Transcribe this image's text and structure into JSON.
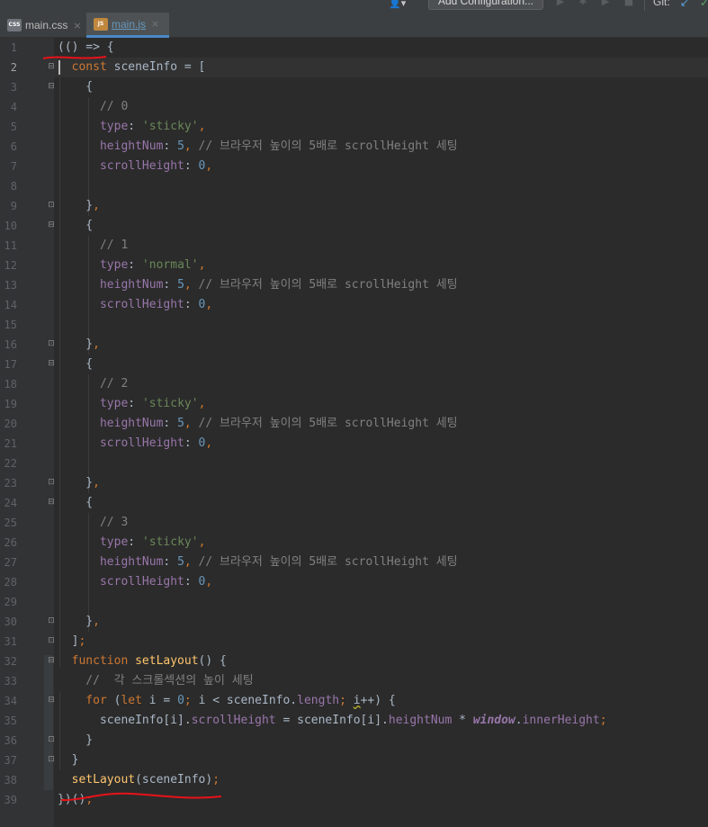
{
  "toolbar": {
    "user_icon": "user-account-icon",
    "config_label": "Add Configuration...",
    "git_label": "Git:"
  },
  "tabs": [
    {
      "label": "main.css",
      "icon_text": "CSS",
      "icon": "css-file-icon",
      "active": false
    },
    {
      "label": "main.js",
      "icon_text": "JS",
      "icon": "js-file-icon",
      "active": true
    }
  ],
  "editor": {
    "current_line": 2,
    "lines": [
      {
        "n": "1",
        "t": [
          [
            "pl",
            "(() => {"
          ]
        ]
      },
      {
        "n": "2",
        "t": [
          [
            "kw",
            "  const "
          ],
          [
            "pl",
            "sceneInfo = ["
          ]
        ]
      },
      {
        "n": "3",
        "t": [
          [
            "pl",
            "    {"
          ]
        ]
      },
      {
        "n": "4",
        "t": [
          [
            "cm",
            "      // 0"
          ]
        ]
      },
      {
        "n": "5",
        "t": [
          [
            "prop",
            "      type"
          ],
          [
            "pl",
            ": "
          ],
          [
            "str",
            "'sticky'"
          ],
          [
            "kw",
            ","
          ]
        ]
      },
      {
        "n": "6",
        "t": [
          [
            "prop",
            "      heightNum"
          ],
          [
            "pl",
            ": "
          ],
          [
            "num",
            "5"
          ],
          [
            "kw",
            ", "
          ],
          [
            "cm",
            "// 브라우저 높이의 5배로 scrollHeight 세팅"
          ]
        ]
      },
      {
        "n": "7",
        "t": [
          [
            "prop",
            "      scrollHeight"
          ],
          [
            "pl",
            ": "
          ],
          [
            "num",
            "0"
          ],
          [
            "kw",
            ","
          ]
        ]
      },
      {
        "n": "8",
        "t": []
      },
      {
        "n": "9",
        "t": [
          [
            "pl",
            "    }"
          ],
          [
            "kw",
            ","
          ]
        ]
      },
      {
        "n": "10",
        "t": [
          [
            "pl",
            "    {"
          ]
        ]
      },
      {
        "n": "11",
        "t": [
          [
            "cm",
            "      // 1"
          ]
        ]
      },
      {
        "n": "12",
        "t": [
          [
            "prop",
            "      type"
          ],
          [
            "pl",
            ": "
          ],
          [
            "str",
            "'normal'"
          ],
          [
            "kw",
            ","
          ]
        ]
      },
      {
        "n": "13",
        "t": [
          [
            "prop",
            "      heightNum"
          ],
          [
            "pl",
            ": "
          ],
          [
            "num",
            "5"
          ],
          [
            "kw",
            ", "
          ],
          [
            "cm",
            "// 브라우저 높이의 5배로 scrollHeight 세팅"
          ]
        ]
      },
      {
        "n": "14",
        "t": [
          [
            "prop",
            "      scrollHeight"
          ],
          [
            "pl",
            ": "
          ],
          [
            "num",
            "0"
          ],
          [
            "kw",
            ","
          ]
        ]
      },
      {
        "n": "15",
        "t": []
      },
      {
        "n": "16",
        "t": [
          [
            "pl",
            "    }"
          ],
          [
            "kw",
            ","
          ]
        ]
      },
      {
        "n": "17",
        "t": [
          [
            "pl",
            "    {"
          ]
        ]
      },
      {
        "n": "18",
        "t": [
          [
            "cm",
            "      // 2"
          ]
        ]
      },
      {
        "n": "19",
        "t": [
          [
            "prop",
            "      type"
          ],
          [
            "pl",
            ": "
          ],
          [
            "str",
            "'sticky'"
          ],
          [
            "kw",
            ","
          ]
        ]
      },
      {
        "n": "20",
        "t": [
          [
            "prop",
            "      heightNum"
          ],
          [
            "pl",
            ": "
          ],
          [
            "num",
            "5"
          ],
          [
            "kw",
            ", "
          ],
          [
            "cm",
            "// 브라우저 높이의 5배로 scrollHeight 세팅"
          ]
        ]
      },
      {
        "n": "21",
        "t": [
          [
            "prop",
            "      scrollHeight"
          ],
          [
            "pl",
            ": "
          ],
          [
            "num",
            "0"
          ],
          [
            "kw",
            ","
          ]
        ]
      },
      {
        "n": "22",
        "t": []
      },
      {
        "n": "23",
        "t": [
          [
            "pl",
            "    }"
          ],
          [
            "kw",
            ","
          ]
        ]
      },
      {
        "n": "24",
        "t": [
          [
            "pl",
            "    {"
          ]
        ]
      },
      {
        "n": "25",
        "t": [
          [
            "cm",
            "      // 3"
          ]
        ]
      },
      {
        "n": "26",
        "t": [
          [
            "prop",
            "      type"
          ],
          [
            "pl",
            ": "
          ],
          [
            "str",
            "'sticky'"
          ],
          [
            "kw",
            ","
          ]
        ]
      },
      {
        "n": "27",
        "t": [
          [
            "prop",
            "      heightNum"
          ],
          [
            "pl",
            ": "
          ],
          [
            "num",
            "5"
          ],
          [
            "kw",
            ", "
          ],
          [
            "cm",
            "// 브라우저 높이의 5배로 scrollHeight 세팅"
          ]
        ]
      },
      {
        "n": "28",
        "t": [
          [
            "prop",
            "      scrollHeight"
          ],
          [
            "pl",
            ": "
          ],
          [
            "num",
            "0"
          ],
          [
            "kw",
            ","
          ]
        ]
      },
      {
        "n": "29",
        "t": []
      },
      {
        "n": "30",
        "t": [
          [
            "pl",
            "    }"
          ],
          [
            "kw",
            ","
          ]
        ]
      },
      {
        "n": "31",
        "t": [
          [
            "pl",
            "  ]"
          ],
          [
            "kw",
            ";"
          ]
        ]
      },
      {
        "n": "32",
        "t": [
          [
            "kw",
            "  function "
          ],
          [
            "fn",
            "setLayout"
          ],
          [
            "pl",
            "() {"
          ]
        ]
      },
      {
        "n": "33",
        "t": [
          [
            "cm",
            "    //  각 스크롤섹션의 높이 세팅"
          ]
        ]
      },
      {
        "n": "34",
        "t": [
          [
            "kw",
            "    for "
          ],
          [
            "pl",
            "("
          ],
          [
            "kw",
            "let "
          ],
          [
            "pl",
            "i = "
          ],
          [
            "num",
            "0"
          ],
          [
            "kw",
            "; "
          ],
          [
            "pl",
            "i < sceneInfo."
          ],
          [
            "prop",
            "length"
          ],
          [
            "kw",
            "; "
          ],
          [
            "pl warn",
            "i"
          ],
          [
            "pl",
            "++) {"
          ]
        ]
      },
      {
        "n": "35",
        "t": [
          [
            "pl",
            "      sceneInfo[i]."
          ],
          [
            "prop",
            "scrollHeight"
          ],
          [
            "pl",
            " = sceneInfo[i]."
          ],
          [
            "prop",
            "heightNum"
          ],
          [
            "pl",
            " * "
          ],
          [
            "glob",
            "window"
          ],
          [
            "pl",
            "."
          ],
          [
            "prop",
            "innerHeight"
          ],
          [
            "kw",
            ";"
          ]
        ]
      },
      {
        "n": "36",
        "t": [
          [
            "pl",
            "    }"
          ]
        ]
      },
      {
        "n": "37",
        "t": [
          [
            "pl",
            "  }"
          ]
        ]
      },
      {
        "n": "38",
        "t": [
          [
            "fn",
            "  setLayout"
          ],
          [
            "pl",
            "(sceneInfo)"
          ],
          [
            "kw",
            ";"
          ]
        ]
      },
      {
        "n": "39",
        "t": [
          [
            "pl",
            "})()"
          ],
          [
            "kw",
            ";"
          ]
        ]
      }
    ]
  },
  "colors": {
    "keyword": "#cc7832",
    "string": "#6a8759",
    "number": "#6897bb",
    "comment": "#808080",
    "property": "#9876aa",
    "function": "#ffc66d",
    "annotation_red": "#e8121a"
  }
}
